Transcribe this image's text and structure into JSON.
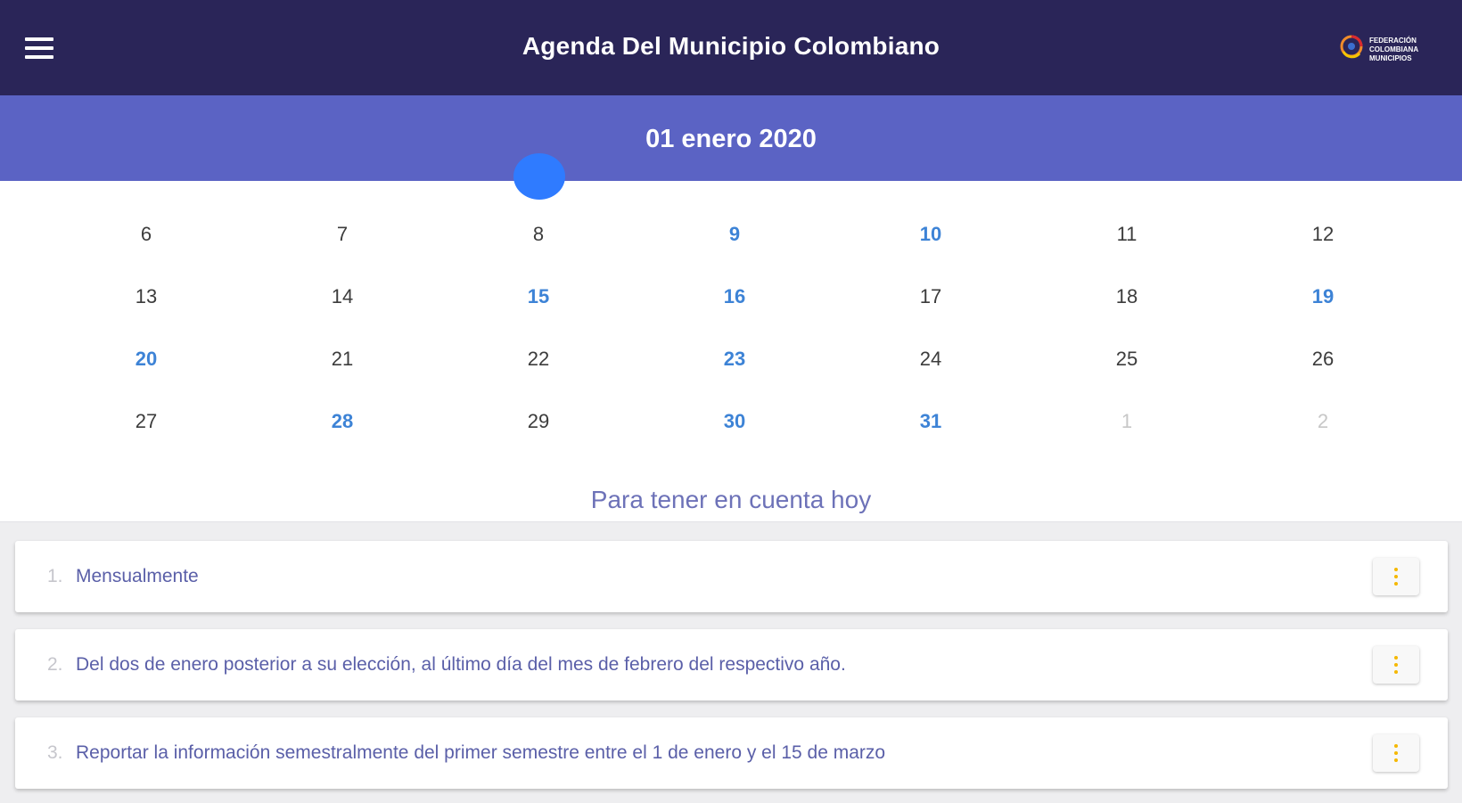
{
  "header": {
    "title": "Agenda Del Municipio Colombiano",
    "menu_icon": "hamburger-menu-icon",
    "logo_icon": "federation-logo-icon",
    "logo_lines": [
      "FEDERACIÓN",
      "COLOMBIANA",
      "MUNICIPIOS"
    ],
    "background": "#2a2558"
  },
  "date_bar": {
    "date": "01 enero 2020",
    "background": "#5b63c4"
  },
  "calendar": {
    "highlight_color": "#3d83d6",
    "selected_color": "#2f7bff",
    "weeks": [
      [
        {
          "d": "6",
          "t": "n"
        },
        {
          "d": "7",
          "t": "n"
        },
        {
          "d": "8",
          "t": "n"
        },
        {
          "d": "9",
          "t": "e"
        },
        {
          "d": "10",
          "t": "e"
        },
        {
          "d": "11",
          "t": "n"
        },
        {
          "d": "12",
          "t": "n"
        }
      ],
      [
        {
          "d": "13",
          "t": "n"
        },
        {
          "d": "14",
          "t": "n"
        },
        {
          "d": "15",
          "t": "e"
        },
        {
          "d": "16",
          "t": "e"
        },
        {
          "d": "17",
          "t": "n"
        },
        {
          "d": "18",
          "t": "n"
        },
        {
          "d": "19",
          "t": "e"
        }
      ],
      [
        {
          "d": "20",
          "t": "e"
        },
        {
          "d": "21",
          "t": "n"
        },
        {
          "d": "22",
          "t": "n"
        },
        {
          "d": "23",
          "t": "e"
        },
        {
          "d": "24",
          "t": "n"
        },
        {
          "d": "25",
          "t": "n"
        },
        {
          "d": "26",
          "t": "n"
        }
      ],
      [
        {
          "d": "27",
          "t": "n"
        },
        {
          "d": "28",
          "t": "e"
        },
        {
          "d": "29",
          "t": "n"
        },
        {
          "d": "30",
          "t": "e"
        },
        {
          "d": "31",
          "t": "e"
        },
        {
          "d": "1",
          "t": "o"
        },
        {
          "d": "2",
          "t": "o"
        }
      ]
    ]
  },
  "today_section": {
    "title": "Para tener en cuenta hoy"
  },
  "items": [
    {
      "number": "1.",
      "text": "Mensualmente",
      "menu_icon": "more-vert-icon"
    },
    {
      "number": "2.",
      "text": "Del dos de enero posterior a su elección, al último día del mes de febrero del respectivo año.",
      "menu_icon": "more-vert-icon"
    },
    {
      "number": "3.",
      "text": "Reportar la información semestralmente del primer semestre entre el 1 de enero y el 15 de marzo",
      "menu_icon": "more-vert-icon"
    }
  ]
}
